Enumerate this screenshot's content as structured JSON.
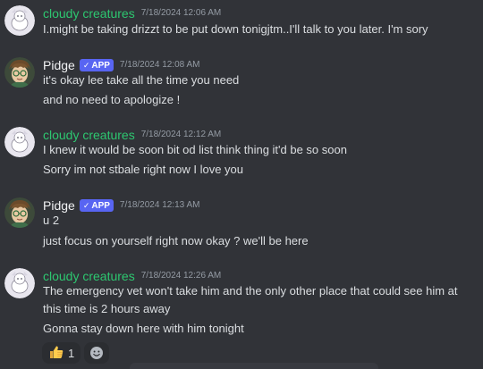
{
  "colors": {
    "background": "#313338",
    "cloudy_name": "#2dc770",
    "app_badge": "#5865f2"
  },
  "messages": [
    {
      "username": "cloudy creatures",
      "timestamp": "7/18/2024 12:06 AM",
      "lines": [
        "I.might be taking drizzt to be put down tonigjtm..I'll talk to you later. I'm sory"
      ]
    },
    {
      "username": "Pidge",
      "badge": "APP",
      "timestamp": "7/18/2024 12:08 AM",
      "lines": [
        "it's okay lee take all the time you need",
        "and no need to apologize !"
      ]
    },
    {
      "username": "cloudy creatures",
      "timestamp": "7/18/2024 12:12 AM",
      "lines": [
        "I knew it would be soon bit od list think thing it'd be so soon",
        "Sorry im not stbale right now I love you"
      ]
    },
    {
      "username": "Pidge",
      "badge": "APP",
      "timestamp": "7/18/2024 12:13 AM",
      "lines": [
        "u 2",
        "just focus on yourself right now okay ? we'll be here"
      ]
    },
    {
      "username": "cloudy creatures",
      "timestamp": "7/18/2024 12:26 AM",
      "lines": [
        "The emergency vet won't take him and the only other place that could see him at this time is 2 hours away",
        "Gonna stay down here with him tonight"
      ],
      "reactions": [
        {
          "emoji": "thumbs-up-icon",
          "count": "1"
        }
      ]
    }
  ]
}
